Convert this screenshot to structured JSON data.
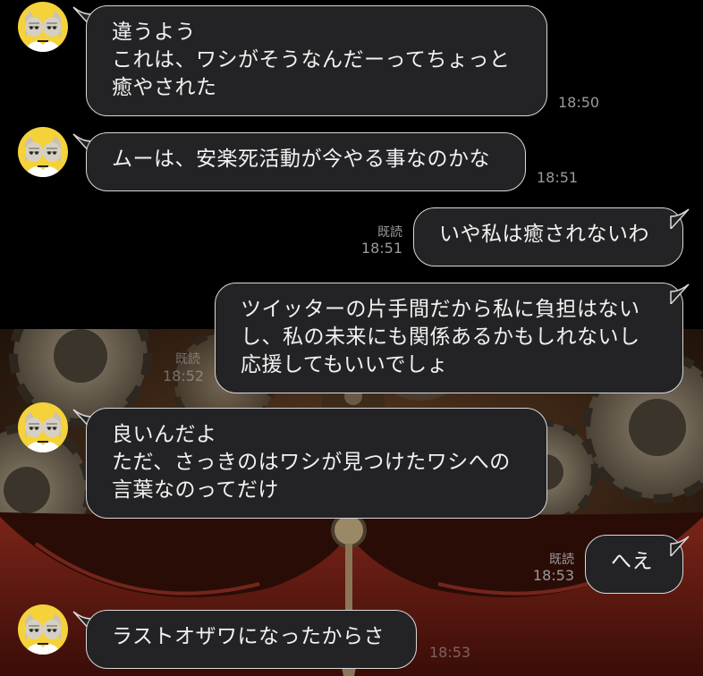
{
  "chat": {
    "messages": [
      {
        "side": "left",
        "lines": [
          "違うよう",
          "これは、ワシがそうなんだーってちょっと",
          "癒やされた"
        ],
        "time": "18:50"
      },
      {
        "side": "left",
        "lines": [
          "ムーは、安楽死活動が今やる事なのかな"
        ],
        "time": "18:51"
      },
      {
        "side": "right",
        "lines": [
          "いや私は癒されないわ"
        ],
        "read": "既読",
        "time": "18:51"
      },
      {
        "side": "right",
        "lines": [
          "ツイッターの片手間だから私に負担はない",
          "し、私の未来にも関係あるかもしれないし",
          "応援してもいいでしょ"
        ],
        "read": "既読",
        "time": "18:52"
      },
      {
        "side": "left",
        "lines": [
          "良いんだよ",
          "ただ、さっきのはワシが見つけたワシへの",
          "言葉なのってだけ"
        ],
        "time": "18:53"
      },
      {
        "side": "right",
        "lines": [
          "へえ"
        ],
        "read": "既読",
        "time": "18:53"
      },
      {
        "side": "left",
        "lines": [
          "ラストオザワになったからさ"
        ],
        "time": "18:53"
      }
    ]
  },
  "colors": {
    "bubble": "#232325",
    "bubble_border": "#d9d9d9",
    "avatar_bg": "#f5d23a",
    "meta_text": "#9a9a9a"
  },
  "icons": {
    "avatar": "cat-avatar-icon"
  }
}
